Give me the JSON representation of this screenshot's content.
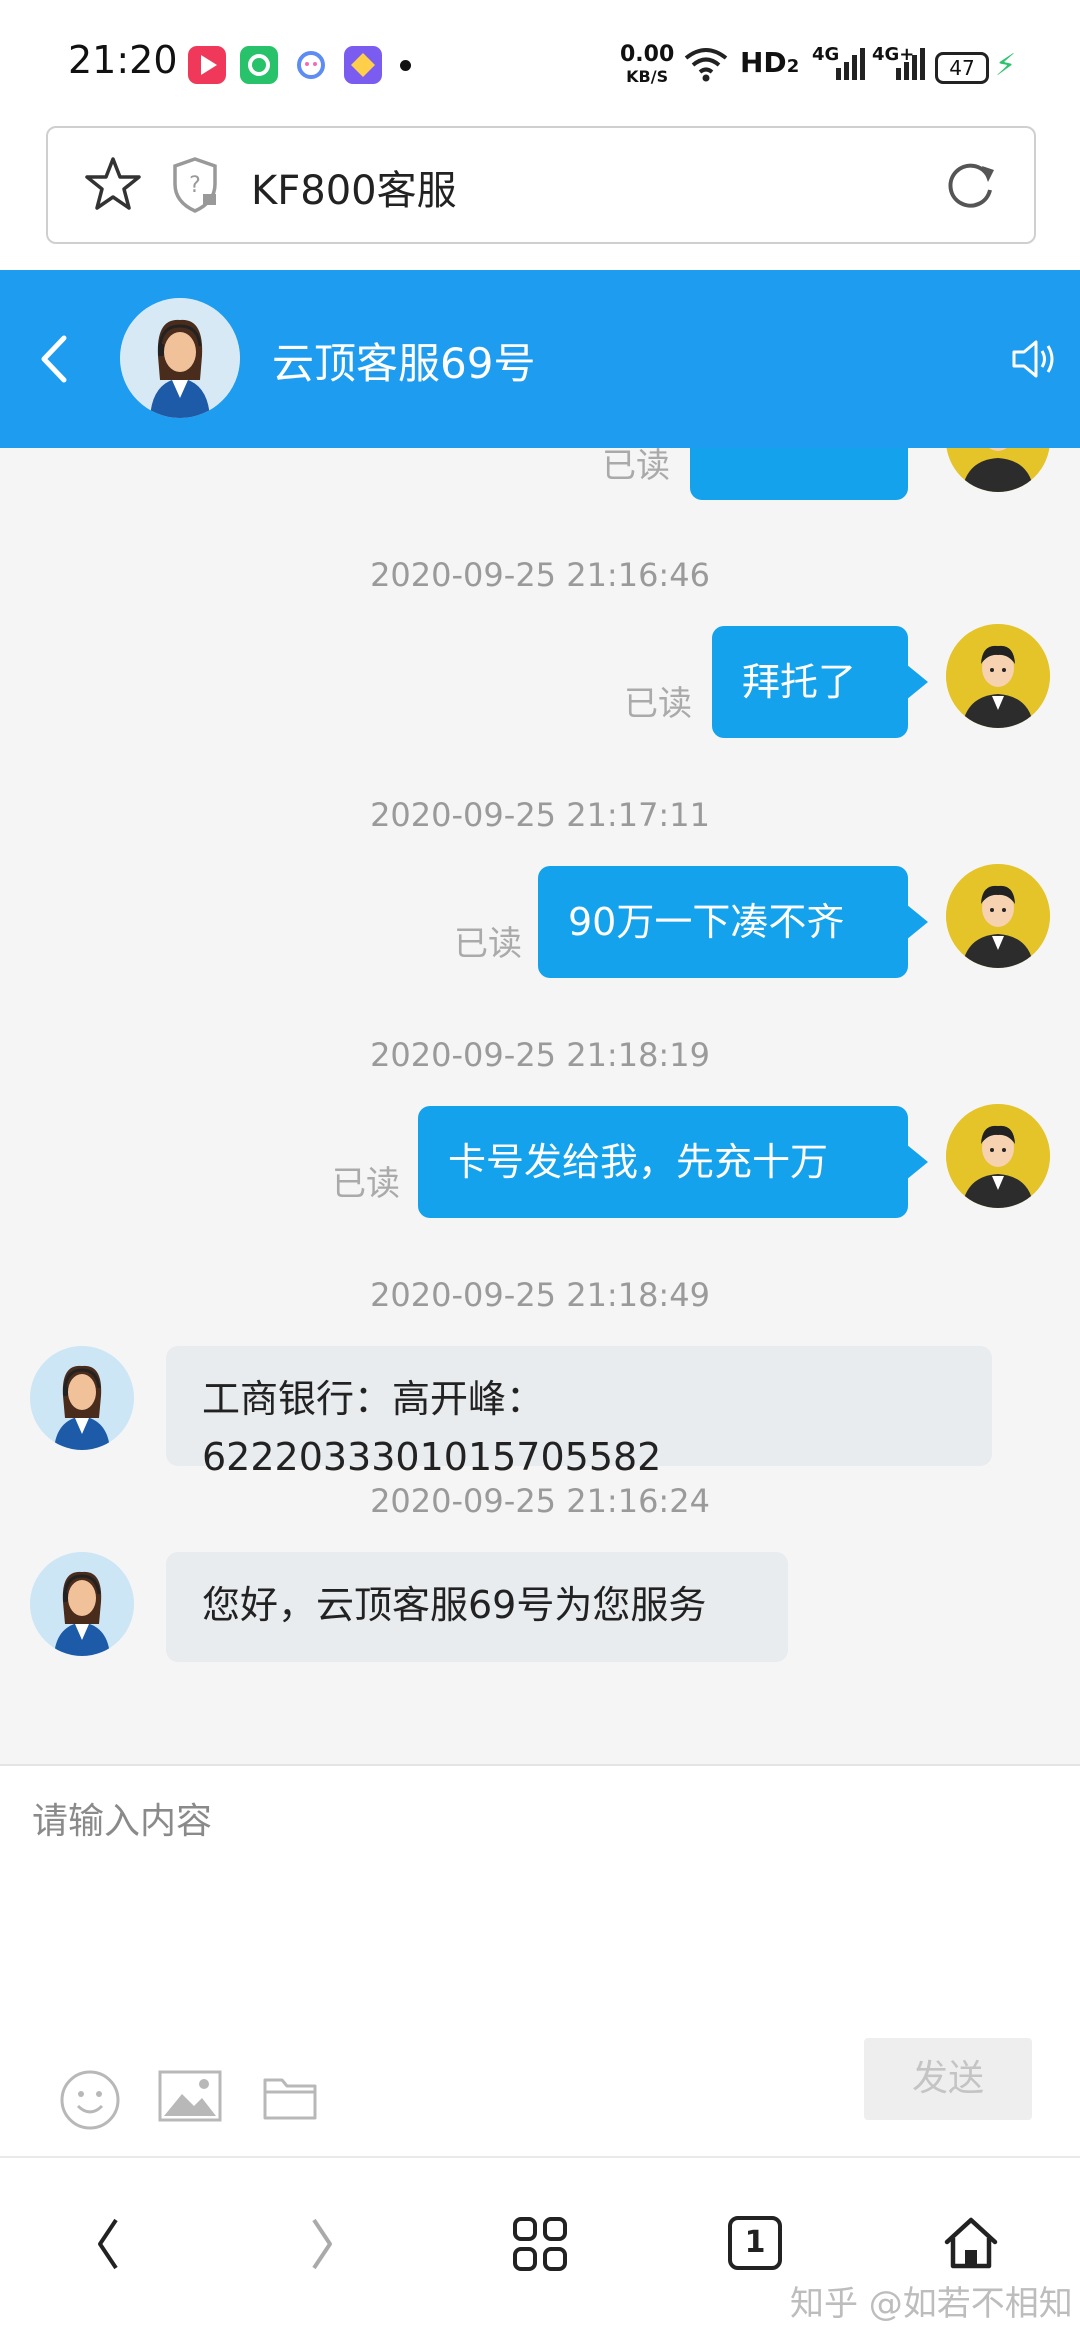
{
  "status_bar": {
    "time": "21:20",
    "net_speed_value": "0.00",
    "net_speed_unit": "KB/S",
    "hd_label": "HD",
    "hd_sub": "2",
    "sim1_label": "4G",
    "sim2_label": "4G+",
    "battery": "47",
    "icons": [
      "app-red-play-icon",
      "app-green-icon",
      "app-qq-icon",
      "app-purple-icon",
      "notification-dot-icon",
      "wifi-icon",
      "signal-icon",
      "battery-icon",
      "charging-bolt-icon"
    ]
  },
  "browser": {
    "url_text": "KF800客服",
    "icons": [
      "star-icon",
      "shield-question-icon",
      "refresh-icon"
    ]
  },
  "chat_header": {
    "title": "云顶客服69号",
    "icons": [
      "back-chevron-icon",
      "speaker-icon"
    ]
  },
  "messages": [
    {
      "type": "timestamp",
      "text": "2020-09-25 21:16:46"
    },
    {
      "type": "outgoing",
      "text": "拜托了",
      "status": "已读"
    },
    {
      "type": "timestamp",
      "text": "2020-09-25 21:17:11"
    },
    {
      "type": "outgoing",
      "text": "90万一下凑不齐",
      "status": "已读"
    },
    {
      "type": "timestamp",
      "text": "2020-09-25 21:18:19"
    },
    {
      "type": "outgoing",
      "text": "卡号发给我，先充十万",
      "status": "已读"
    },
    {
      "type": "timestamp",
      "text": "2020-09-25 21:18:49"
    },
    {
      "type": "incoming",
      "line1": "工商银行：高开峰：",
      "line2": "6222033301015705582"
    },
    {
      "type": "timestamp",
      "text": "2020-09-25 21:16:24"
    },
    {
      "type": "incoming",
      "line1": "您好，云顶客服69号为您服务"
    }
  ],
  "partial_top": {
    "status": "已读"
  },
  "input": {
    "placeholder": "请输入内容",
    "send_label": "发送",
    "icons": [
      "emoji-icon",
      "image-icon",
      "folder-icon"
    ]
  },
  "navbar": {
    "tab_count": "1",
    "watermark": "知乎 @如若不相知",
    "icons": [
      "nav-back-icon",
      "nav-forward-icon",
      "nav-grid-icon",
      "nav-tabs-icon",
      "nav-home-icon"
    ]
  },
  "colors": {
    "header_blue": "#1e9cf0",
    "bubble_blue": "#15a2ec",
    "incoming_bubble": "#e8ecef",
    "charging_green": "#2bc36b"
  }
}
